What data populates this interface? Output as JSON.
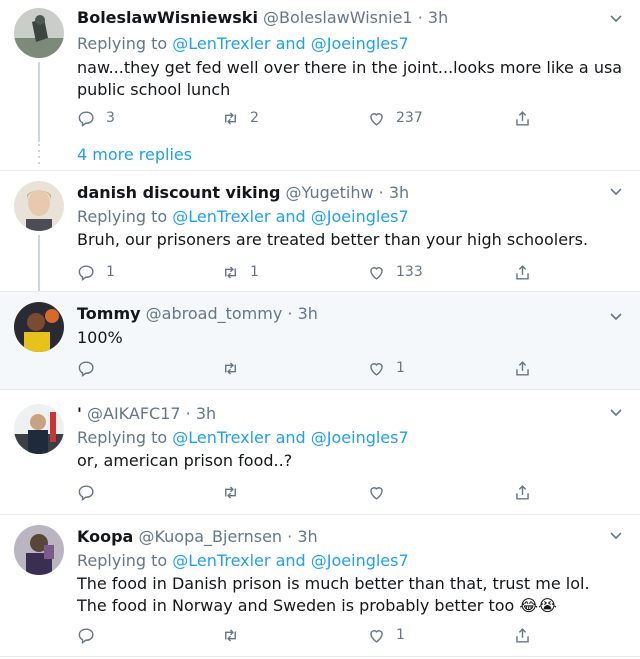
{
  "reply_prefix": "Replying to",
  "reply_and": "and",
  "tweets": [
    {
      "name": "BoleslawWisniewski",
      "handle": "@BoleslawWisnie1",
      "dot": "·",
      "time": "3h",
      "replying": true,
      "mention1": "@LenTrexler",
      "mention2": "@Joeingles7",
      "text": "naw...they get fed well over there in the joint...looks more like a usa public school lunch",
      "replies": "3",
      "retweets": "2",
      "likes": "237"
    },
    {
      "name": "danish discount viking",
      "handle": "@Yugetihw",
      "dot": "·",
      "time": "3h",
      "replying": true,
      "mention1": "@LenTrexler",
      "mention2": "@Joeingles7",
      "text": "Bruh, our prisoners are treated better than your high schoolers.",
      "replies": "1",
      "retweets": "1",
      "likes": "133"
    },
    {
      "name": "Tommy",
      "handle": "@abroad_tommy",
      "dot": "·",
      "time": "3h",
      "replying": false,
      "text": "100%",
      "replies": "",
      "retweets": "",
      "likes": "1"
    },
    {
      "name": "'",
      "handle": "@AIKAFC17",
      "dot": "·",
      "time": "3h",
      "replying": true,
      "mention1": "@LenTrexler",
      "mention2": "@Joeingles7",
      "text": "or, american prison food..?",
      "replies": "",
      "retweets": "",
      "likes": ""
    },
    {
      "name": "Koopa",
      "handle": "@Kuopa_Bjernsen",
      "dot": "·",
      "time": "3h",
      "replying": true,
      "mention1": "@LenTrexler",
      "mention2": "@Joeingles7",
      "text": "The food in Danish prison is much better than that, trust me lol.  The food in Norway and Sweden is probably better too 😂😭",
      "replies": "",
      "retweets": "",
      "likes": "1"
    }
  ],
  "more_replies": "4 more replies",
  "icons": {
    "reply": "reply-icon",
    "retweet": "retweet-icon",
    "like": "heart-icon",
    "share": "share-icon",
    "menu": "chevron-down-icon"
  },
  "colors": {
    "link": "#1da1f2",
    "muted": "#657786",
    "highlight_bg": "#f5f8fa",
    "text": "#14171a"
  }
}
